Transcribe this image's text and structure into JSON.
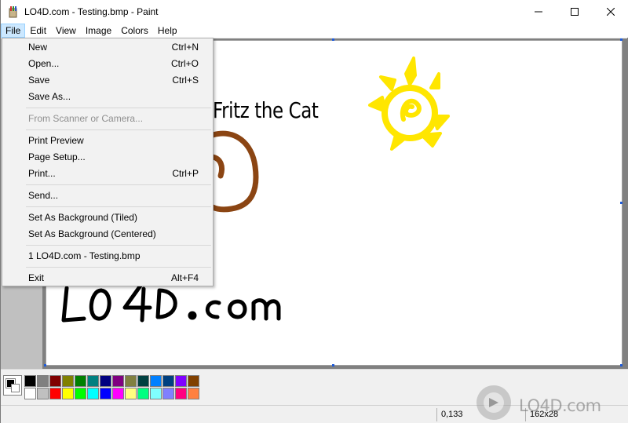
{
  "window": {
    "title": "LO4D.com - Testing.bmp - Paint",
    "controls": [
      "minimize",
      "maximize",
      "close"
    ]
  },
  "menubar": {
    "items": [
      "File",
      "Edit",
      "View",
      "Image",
      "Colors",
      "Help"
    ],
    "active": "File"
  },
  "file_menu": {
    "groups": [
      [
        {
          "label": "New",
          "shortcut": "Ctrl+N"
        },
        {
          "label": "Open...",
          "shortcut": "Ctrl+O"
        },
        {
          "label": "Save",
          "shortcut": "Ctrl+S"
        },
        {
          "label": "Save As...",
          "shortcut": ""
        }
      ],
      [
        {
          "label": "From Scanner or Camera...",
          "shortcut": "",
          "disabled": true
        }
      ],
      [
        {
          "label": "Print Preview",
          "shortcut": ""
        },
        {
          "label": "Page Setup...",
          "shortcut": ""
        },
        {
          "label": "Print...",
          "shortcut": "Ctrl+P"
        }
      ],
      [
        {
          "label": "Send...",
          "shortcut": ""
        }
      ],
      [
        {
          "label": "Set As Background (Tiled)",
          "shortcut": ""
        },
        {
          "label": "Set As Background (Centered)",
          "shortcut": ""
        }
      ],
      [
        {
          "label": "1 LO4D.com - Testing.bmp",
          "shortcut": ""
        }
      ],
      [
        {
          "label": "Exit",
          "shortcut": "Alt+F4"
        }
      ]
    ]
  },
  "canvas": {
    "caption_text": "Fritz the Cat",
    "handwritten_text": "LO4D.com",
    "drawing_colors": {
      "sun": "#ffe600",
      "cat": "#8b4513",
      "ink": "#000000"
    }
  },
  "palette": {
    "foreground": "#000000",
    "background": "#ffffff",
    "row1": [
      "#000000",
      "#808080",
      "#800000",
      "#808000",
      "#008000",
      "#008080",
      "#000080",
      "#800080",
      "#808040",
      "#004040",
      "#0080ff",
      "#004080",
      "#8000ff",
      "#804000"
    ],
    "row2": [
      "#ffffff",
      "#c0c0c0",
      "#ff0000",
      "#ffff00",
      "#00ff00",
      "#00ffff",
      "#0000ff",
      "#ff00ff",
      "#ffff80",
      "#00ff80",
      "#80ffff",
      "#8080ff",
      "#ff0080",
      "#ff8040"
    ]
  },
  "status": {
    "coords": "0,133",
    "size": "162x28"
  },
  "watermark": {
    "text": "LO4D.com"
  }
}
